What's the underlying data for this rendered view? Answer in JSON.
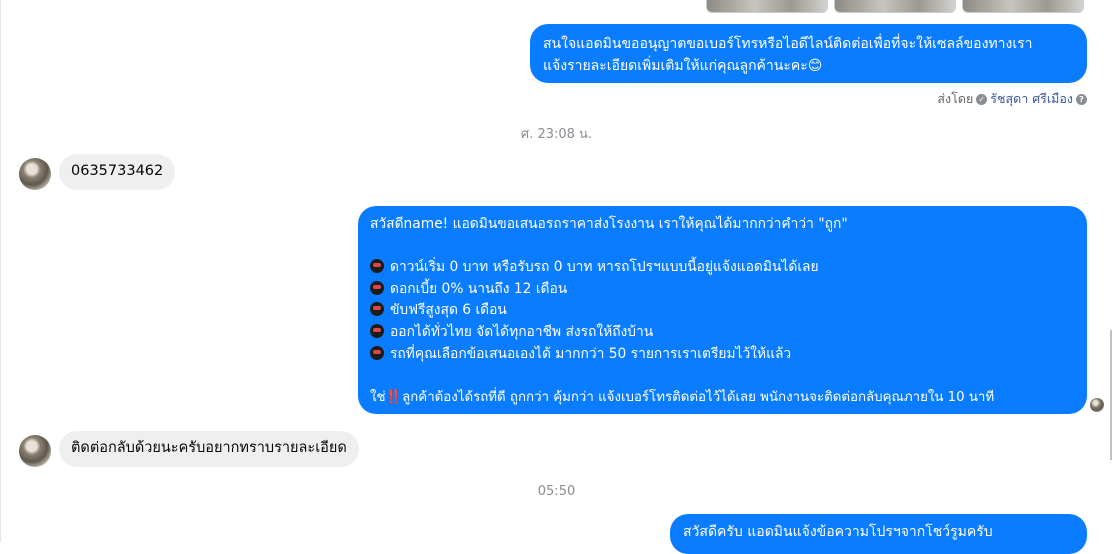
{
  "thread": {
    "msg_out_1": {
      "line1": "สนใจแอดมินขออนุญาตขอเบอร์โทรหรือไอดีไลน์ติดต่อเพื่อที่จะให้เซลล์ของทางเรา",
      "line2": "แจ้งรายละเอียดเพิ่มเติมให้แก่คุณลูกค้านะคะ😊"
    },
    "sent_by": {
      "prefix": "ส่งโดย",
      "name": "รัชสุดา ศรีเมือง"
    },
    "timestamp_1": "ศ. 23:08 น.",
    "msg_in_1": "0635733462",
    "msg_out_2": {
      "intro": "สวัสดีname! แอดมินขอเสนอรถราคาส่งโรงงาน เราให้คุณได้มากกว่าคำว่า \"ถูก\"",
      "bullets": [
        "ดาวน์เริ่ม 0 บาท หรือรับรถ 0 บาท หารถโปรฯแบบนี้อยู่แจ้งแอดมินได้เลย",
        "ดอกเบี้ย 0% นานถึง 12 เดือน",
        "ขับฟรีสูงสุด 6 เดือน",
        "ออกได้ทั่วไทย จัดได้ทุกอาชีพ ส่งรถให้ถึงบ้าน",
        "รถที่คุณเลือกข้อเสนอเองได้ มากกว่า 50 รายการเราเตรียมไว้ให้แล้ว"
      ],
      "closing_prefix": "ใช่",
      "closing_mark": "‼️",
      "closing": "ลูกค้าต้องได้รถที่ดี ถูกกว่า คุ้มกว่า แจ้งเบอร์โทรติดต่อไว้ได้เลย พนักงานจะติดต่อกลับคุณภายใน 10 นาที"
    },
    "msg_in_2": "ติดต่อกลับด้วยนะครับอยากทราบรายละเอียด",
    "timestamp_2": "05:50",
    "msg_out_3_partial": "สวัสดีครับ แอดมินแจ้งข้อความโปรฯจากโชว์รูมครับ"
  },
  "icons": {
    "sent_by_marker": "check-circle-icon",
    "help": "question-circle-icon",
    "bullet": "car-emoji-icon"
  },
  "colors": {
    "outgoing_bubble": "#0a7cff",
    "incoming_bubble": "#efefef",
    "timestamp_text": "#8a8d91",
    "sender_name": "#385898"
  }
}
